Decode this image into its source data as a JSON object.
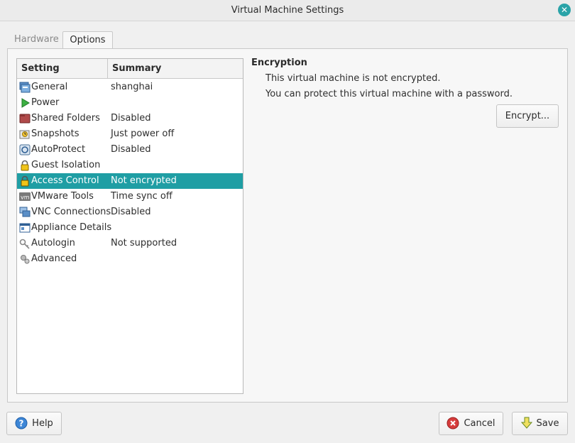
{
  "window": {
    "title": "Virtual Machine Settings",
    "close_icon": "close-icon"
  },
  "tabs": [
    {
      "label": "Hardware",
      "active": false
    },
    {
      "label": "Options",
      "active": true
    }
  ],
  "list": {
    "headers": {
      "setting": "Setting",
      "summary": "Summary"
    },
    "rows": [
      {
        "name": "General",
        "summary": "shanghai",
        "icon": "general-icon"
      },
      {
        "name": "Power",
        "summary": "",
        "icon": "power-icon"
      },
      {
        "name": "Shared Folders",
        "summary": "Disabled",
        "icon": "shared-folders-icon"
      },
      {
        "name": "Snapshots",
        "summary": "Just power off",
        "icon": "snapshots-icon"
      },
      {
        "name": "AutoProtect",
        "summary": "Disabled",
        "icon": "autoprotect-icon"
      },
      {
        "name": "Guest Isolation",
        "summary": "",
        "icon": "guest-isolation-icon"
      },
      {
        "name": "Access Control",
        "summary": "Not encrypted",
        "icon": "access-control-icon",
        "selected": true
      },
      {
        "name": "VMware Tools",
        "summary": "Time sync off",
        "icon": "vmware-tools-icon"
      },
      {
        "name": "VNC Connections",
        "summary": "Disabled",
        "icon": "vnc-connections-icon"
      },
      {
        "name": "Appliance Details",
        "summary": "",
        "icon": "appliance-details-icon"
      },
      {
        "name": "Autologin",
        "summary": "Not supported",
        "icon": "autologin-icon"
      },
      {
        "name": "Advanced",
        "summary": "",
        "icon": "advanced-icon"
      }
    ]
  },
  "detail": {
    "title": "Encryption",
    "line1": "This virtual machine is not encrypted.",
    "line2": "You can protect this virtual machine with a password.",
    "encrypt_label": "Encrypt..."
  },
  "footer": {
    "help_label": "Help",
    "cancel_label": "Cancel",
    "save_label": "Save"
  },
  "colors": {
    "selection": "#1f9ea4",
    "accent": "#2aa3a8"
  }
}
